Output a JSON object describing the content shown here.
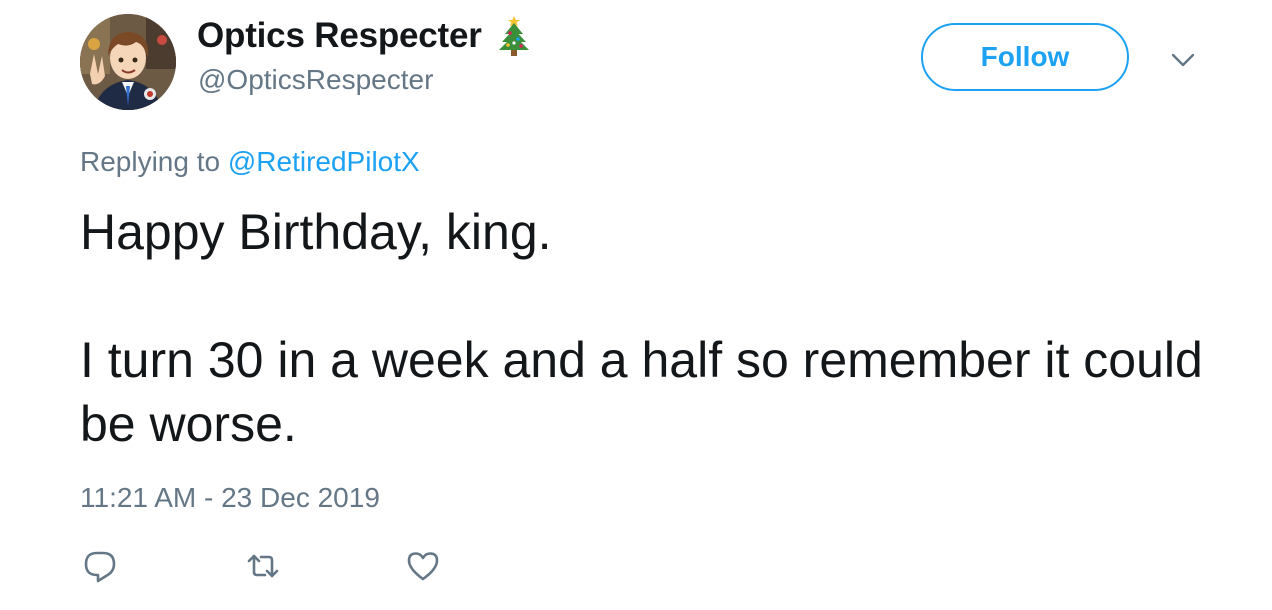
{
  "author": {
    "display_name": "Optics Respecter",
    "name_emoji_icon": "christmas-tree-icon",
    "handle": "@OpticsRespecter",
    "avatar_icon": "anime-avatar"
  },
  "header": {
    "follow_label": "Follow",
    "menu_icon": "chevron-down-icon"
  },
  "reply": {
    "prefix": "Replying to",
    "target": "@RetiredPilotX"
  },
  "tweet": {
    "paragraphs": [
      "Happy Birthday, king.",
      "I turn 30 in a week and a half so remember it could be worse."
    ],
    "timestamp": "11:21 AM - 23 Dec 2019"
  },
  "actions": [
    {
      "name": "reply",
      "icon": "reply-icon"
    },
    {
      "name": "retweet",
      "icon": "retweet-icon"
    },
    {
      "name": "like",
      "icon": "heart-icon"
    }
  ],
  "colors": {
    "accent": "#1da1f2",
    "text": "#14171a",
    "secondary_text": "#657786"
  }
}
